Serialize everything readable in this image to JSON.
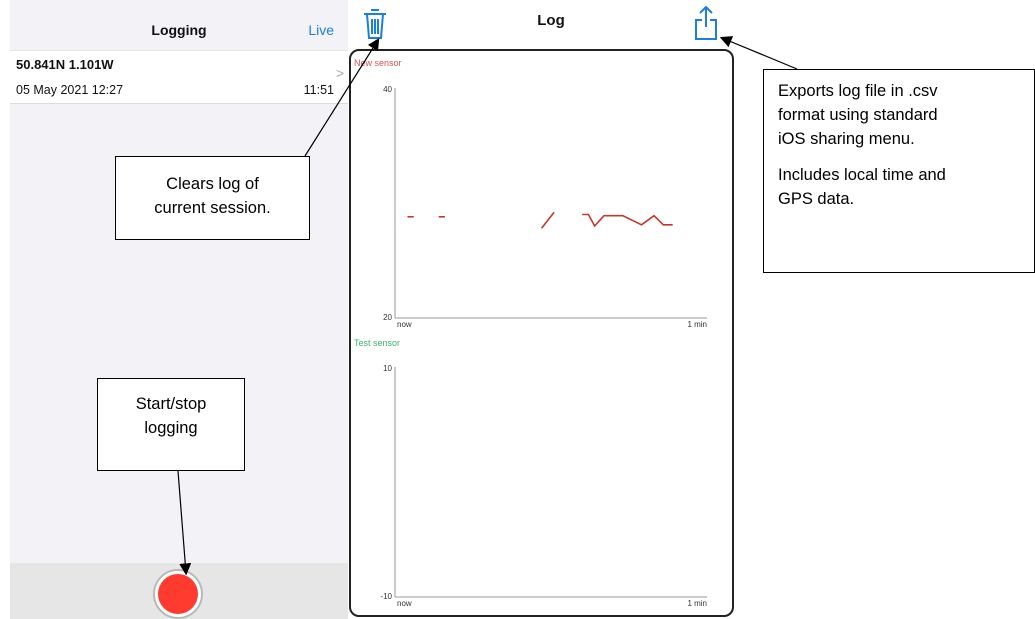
{
  "left": {
    "title": "Logging",
    "live_label": "Live",
    "entry": {
      "coords": "50.841N 1.101W",
      "date": "05 May 2021 12:27",
      "duration": "11:51",
      "chevron": ">"
    }
  },
  "log": {
    "title": "Log",
    "trash_icon": "trash-icon",
    "share_icon": "share-icon"
  },
  "colors": {
    "accent": "#1a7fe0",
    "record": "#ff3b30",
    "new_sensor": "#c0392b",
    "test_sensor": "#3cb371"
  },
  "chart_data": [
    {
      "type": "line",
      "title": "New sensor",
      "ylim": [
        20,
        40
      ],
      "y_ticks": [
        "40",
        "20"
      ],
      "x_ticks": [
        "now",
        "1 min"
      ],
      "segments": [
        [
          [
            0.04,
            28.8
          ],
          [
            0.06,
            28.8
          ]
        ],
        [
          [
            0.14,
            28.8
          ],
          [
            0.16,
            28.8
          ]
        ],
        [
          [
            0.47,
            27.8
          ],
          [
            0.51,
            29.2
          ]
        ],
        [
          [
            0.6,
            29.0
          ],
          [
            0.62,
            29.0
          ],
          [
            0.64,
            28.0
          ],
          [
            0.67,
            28.9
          ],
          [
            0.73,
            28.9
          ],
          [
            0.79,
            28.1
          ],
          [
            0.83,
            28.9
          ],
          [
            0.86,
            28.1
          ],
          [
            0.89,
            28.1
          ]
        ]
      ]
    },
    {
      "type": "line",
      "title": "Test sensor",
      "ylim": [
        -10,
        10
      ],
      "y_ticks": [
        "10",
        "-10"
      ],
      "x_ticks": [
        "now",
        "1 min"
      ],
      "segments": []
    }
  ],
  "callouts": {
    "clear": [
      "Clears log of",
      "current session."
    ],
    "export_p1": [
      "Exports log file in .csv",
      "format using standard",
      "iOS sharing menu."
    ],
    "export_p2": [
      "Includes local time and",
      "GPS data."
    ],
    "record": [
      "Start/stop",
      "logging"
    ]
  }
}
